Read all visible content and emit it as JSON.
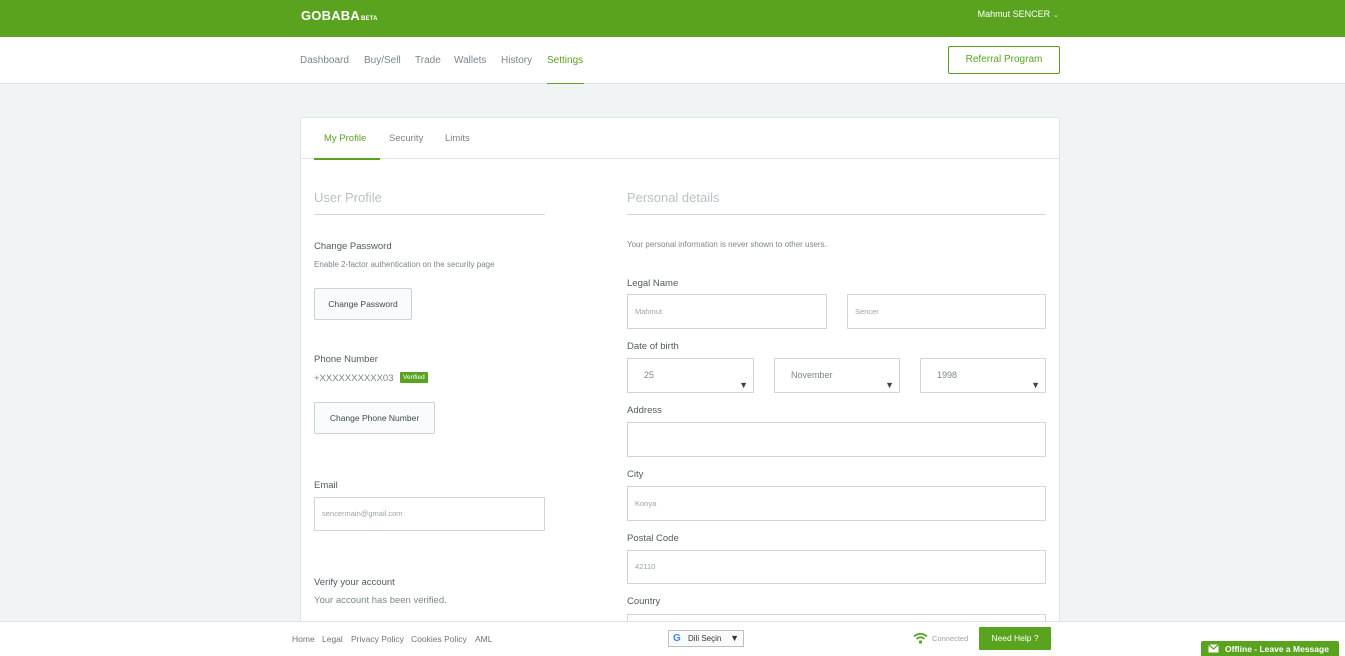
{
  "header": {
    "brand": "GOBABA",
    "brand_tag": "BETA",
    "user_name": "Mahmut SENCER",
    "user_chevron": "⌄"
  },
  "nav": {
    "items": [
      {
        "label": "Dashboard",
        "active": false
      },
      {
        "label": "Buy/Sell",
        "active": false
      },
      {
        "label": "Trade",
        "active": false
      },
      {
        "label": "Wallets",
        "active": false
      },
      {
        "label": "History",
        "active": false
      },
      {
        "label": "Settings",
        "active": true
      }
    ],
    "referral_label": "Referral Program"
  },
  "tabs": [
    {
      "label": "My Profile",
      "active": true
    },
    {
      "label": "Security",
      "active": false
    },
    {
      "label": "Limits",
      "active": false
    }
  ],
  "user_profile": {
    "title": "User Profile",
    "change_password": {
      "label": "Change Password",
      "hint": "Enable 2-factor authentication on the security page",
      "button": "Change Password"
    },
    "phone": {
      "label": "Phone Number",
      "value": "+XXXXXXXXXX03",
      "badge": "Verified",
      "button": "Change Phone Number"
    },
    "email": {
      "label": "Email",
      "value": "sencermain@gmail.com"
    },
    "verify": {
      "label": "Verify your account",
      "status": "Your account has been verified."
    }
  },
  "personal_details": {
    "title": "Personal details",
    "note": "Your personal information is never shown to other users.",
    "legal_name": {
      "label": "Legal Name",
      "first": "Mahmut",
      "last": "Sencer"
    },
    "dob": {
      "label": "Date of birth",
      "day": "25",
      "month": "November",
      "year": "1998"
    },
    "address": {
      "label": "Address",
      "value": ""
    },
    "city": {
      "label": "City",
      "value": "Konya"
    },
    "postal_code": {
      "label": "Postal Code",
      "value": "42110"
    },
    "country": {
      "label": "Country"
    }
  },
  "footer": {
    "links": [
      "Home",
      "Legal",
      "Privacy Policy",
      "Cookies Policy",
      "AML"
    ],
    "language_label": "Dili Seçin",
    "connection_status": "Connected",
    "help_button": "Need Help ?",
    "chat_label": "Offline - Leave a Message"
  },
  "colors": {
    "brand_green": "#5aa31f",
    "page_bg": "#f1f4f5"
  }
}
